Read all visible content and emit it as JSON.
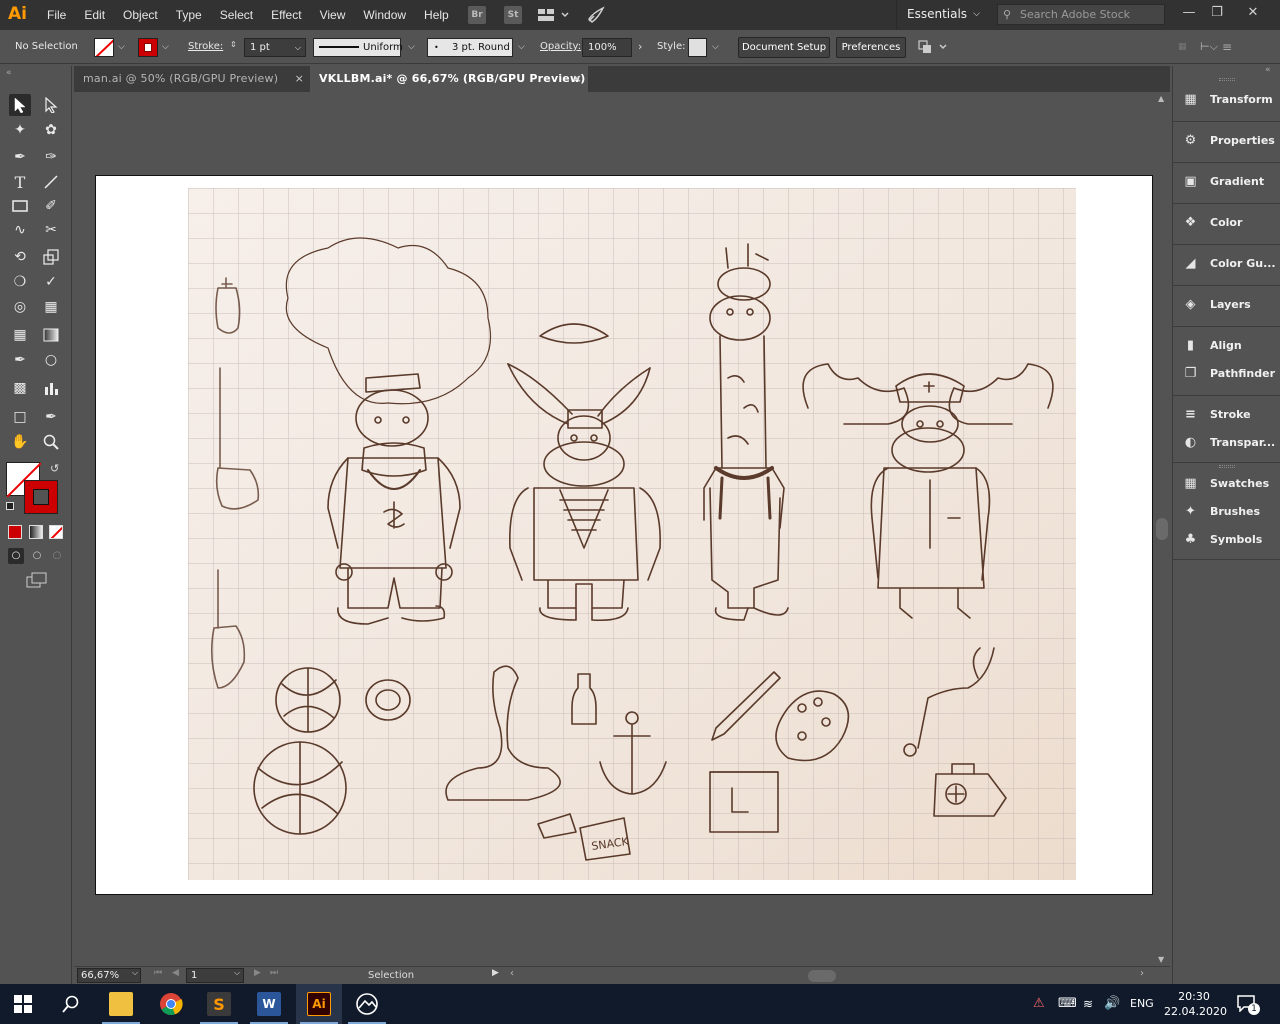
{
  "app": {
    "logo": "Ai",
    "menus": [
      "File",
      "Edit",
      "Object",
      "Type",
      "Select",
      "Effect",
      "View",
      "Window",
      "Help"
    ],
    "bridge_label": "Br",
    "stock_label": "St",
    "workspace": "Essentials",
    "search_placeholder": "Search Adobe Stock"
  },
  "control": {
    "selection_status": "No Selection",
    "stroke_label": "Stroke:",
    "stroke_weight": "1 pt",
    "stroke_profile": "Uniform",
    "brush": "3 pt. Round",
    "opacity_label": "Opacity:",
    "opacity_value": "100%",
    "style_label": "Style:",
    "document_setup": "Document Setup",
    "preferences": "Preferences"
  },
  "tabs": [
    {
      "label": "man.ai @ 50% (RGB/GPU Preview)",
      "active": false
    },
    {
      "label": "VKLLBM.ai* @ 66,67% (RGB/GPU Preview)",
      "active": true
    }
  ],
  "status": {
    "zoom": "66,67%",
    "page": "1",
    "mode": "Selection"
  },
  "panels": [
    {
      "label": "Transform",
      "icon": "transform-icon"
    },
    {
      "label": "Properties",
      "icon": "properties-icon"
    },
    {
      "label": "Gradient",
      "icon": "gradient-icon"
    },
    {
      "label": "Color",
      "icon": "color-icon"
    },
    {
      "label": "Color Gu...",
      "icon": "color-guide-icon"
    },
    {
      "label": "Layers",
      "icon": "layers-icon"
    },
    {
      "label": "Align",
      "icon": "align-icon"
    },
    {
      "label": "Pathfinder",
      "icon": "pathfinder-icon"
    },
    {
      "label": "Stroke",
      "icon": "stroke-icon"
    },
    {
      "label": "Transpar...",
      "icon": "transparency-icon"
    },
    {
      "label": "Swatches",
      "icon": "swatches-icon"
    },
    {
      "label": "Brushes",
      "icon": "brushes-icon"
    },
    {
      "label": "Symbols",
      "icon": "symbols-icon"
    }
  ],
  "sketch_text": "SNACK",
  "taskbar": {
    "language": "ENG",
    "time": "20:30",
    "date": "22.04.2020",
    "notification_count": "1",
    "word_glyph": "W",
    "ai_glyph": "Ai"
  },
  "colors": {
    "accent_red": "#cc0000",
    "ai_orange": "#ff9a00",
    "taskbar": "#101a2a"
  }
}
